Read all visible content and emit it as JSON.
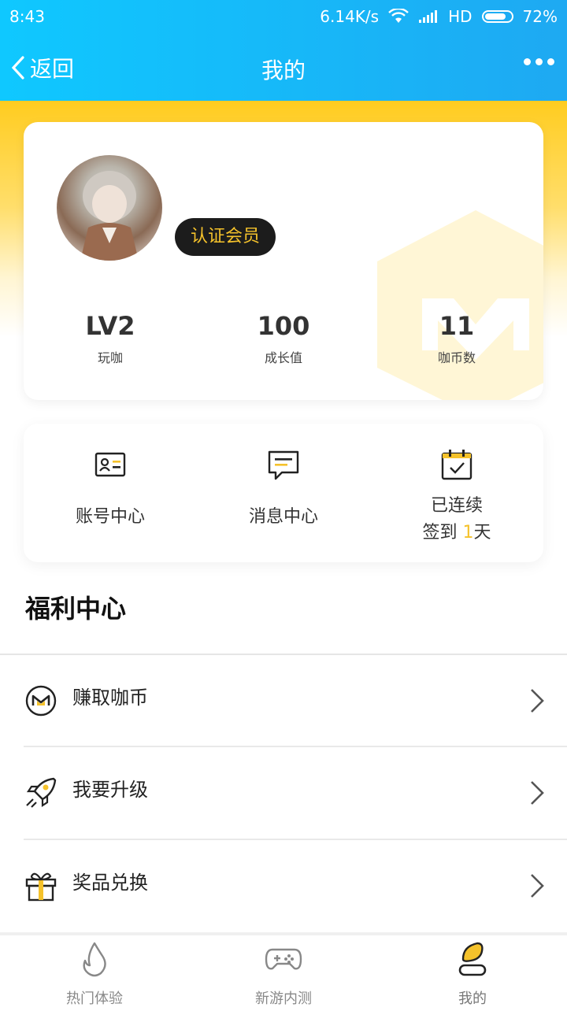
{
  "status": {
    "time": "8:43",
    "speed": "6.14K/s",
    "network": "HD",
    "battery": "72%"
  },
  "nav": {
    "back_label": "返回",
    "title": "我的"
  },
  "profile": {
    "badge": "认证会员",
    "stats": [
      {
        "value": "LV2",
        "label": "玩咖"
      },
      {
        "value": "100",
        "label": "成长值"
      },
      {
        "value": "11",
        "label": "咖币数"
      }
    ]
  },
  "quick": {
    "account": "账号中心",
    "message": "消息中心",
    "checkin_line1": "已连续",
    "checkin_prefix": "签到 ",
    "checkin_days": "1",
    "checkin_suffix": "天"
  },
  "welfare": {
    "title": "福利中心",
    "items": [
      {
        "label": "赚取咖币",
        "icon": "coin-icon"
      },
      {
        "label": "我要升级",
        "icon": "rocket-icon"
      },
      {
        "label": "奖品兑换",
        "icon": "gift-icon"
      }
    ]
  },
  "tabs": [
    {
      "label": "热门体验",
      "icon": "flame-icon"
    },
    {
      "label": "新游内测",
      "icon": "gamepad-icon"
    },
    {
      "label": "我的",
      "icon": "profile-icon",
      "active": true
    }
  ],
  "colors": {
    "accent": "#f5c22b",
    "header_blue": "#1ea9f2"
  }
}
